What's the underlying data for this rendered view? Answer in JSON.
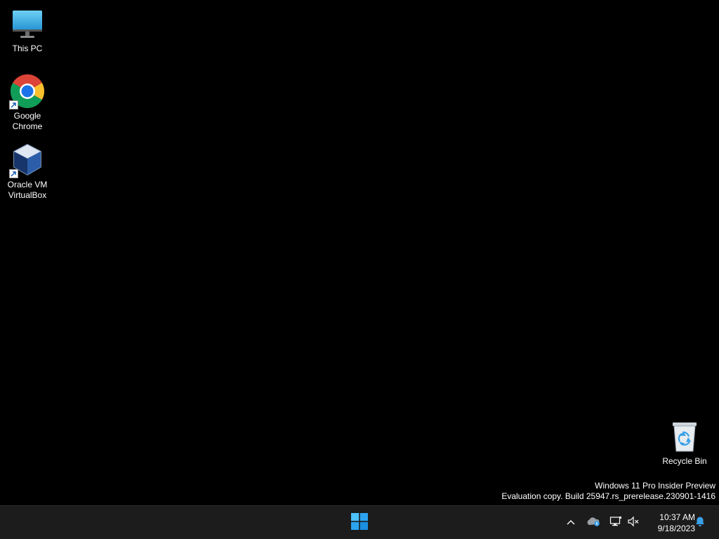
{
  "desktop": {
    "icons": [
      {
        "label": "This PC",
        "icon": "monitor-icon"
      },
      {
        "label": "Google\nChrome",
        "icon": "chrome-icon",
        "shortcut": true
      },
      {
        "label": "Oracle VM\nVirtualBox",
        "icon": "virtualbox-icon",
        "shortcut": true
      },
      {
        "label": "Recycle Bin",
        "icon": "recycle-bin-icon"
      }
    ],
    "watermark": {
      "line1": "Windows 11 Pro Insider Preview",
      "line2": "Evaluation copy. Build 25947.rs_prerelease.230901-1416"
    }
  },
  "taskbar": {
    "start_icon": "windows-logo-icon",
    "tray": [
      "chevron-up-icon",
      "onedrive-icon",
      "network-icon",
      "volume-muted-icon"
    ],
    "clock": {
      "time": "10:37 AM",
      "date": "9/18/2023"
    },
    "notifications_icon": "bell-icon"
  },
  "colors": {
    "desktop_bg": "#000000",
    "taskbar_bg": "#1c1c1c",
    "accent": "#3aa0e8"
  }
}
